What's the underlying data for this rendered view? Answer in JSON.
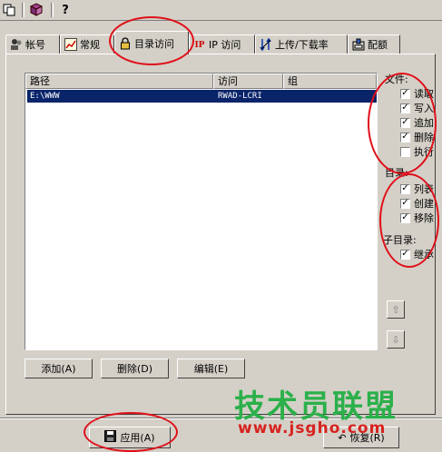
{
  "toolbar": {
    "icons": [
      "copy-icon",
      "book-icon",
      "help-icon"
    ]
  },
  "tabs": [
    {
      "label": "帐号",
      "icon": "users-icon"
    },
    {
      "label": "常规",
      "icon": "chart-icon"
    },
    {
      "label": "目录访问",
      "icon": "lock-icon",
      "active": true
    },
    {
      "label": "IP 访问",
      "icon": "ip-icon"
    },
    {
      "label": "上传/下载率",
      "icon": "transfer-icon"
    },
    {
      "label": "配额",
      "icon": "quota-icon"
    }
  ],
  "list": {
    "columns": [
      "路径",
      "访问",
      "组"
    ],
    "rows": [
      {
        "path": "E:\\WWW",
        "access": "RWAD-LCRI",
        "group": "",
        "selected": true
      }
    ]
  },
  "files": {
    "label": "文件:",
    "items": [
      {
        "label": "读取",
        "checked": true
      },
      {
        "label": "写入",
        "checked": true
      },
      {
        "label": "追加",
        "checked": true
      },
      {
        "label": "删除",
        "checked": true
      },
      {
        "label": "执行",
        "checked": false
      }
    ]
  },
  "dirs": {
    "label": "目录:",
    "items": [
      {
        "label": "列表",
        "checked": true
      },
      {
        "label": "创建",
        "checked": true
      },
      {
        "label": "移除",
        "checked": true
      }
    ]
  },
  "subdirs": {
    "label": "子目录:",
    "items": [
      {
        "label": "继承",
        "checked": true
      }
    ]
  },
  "buttons": {
    "add": "添加(A)",
    "delete": "删除(D)",
    "edit": "编辑(E)",
    "apply": "应用(A)",
    "reset": "恢复(R)"
  },
  "watermark": {
    "title": "技术员联盟",
    "url": "www.jsgho.com"
  },
  "colors": {
    "selection": "#0a246a",
    "annotation": "#e0101a",
    "watermark_green": "#2bb04a",
    "watermark_red": "#d6231f"
  }
}
